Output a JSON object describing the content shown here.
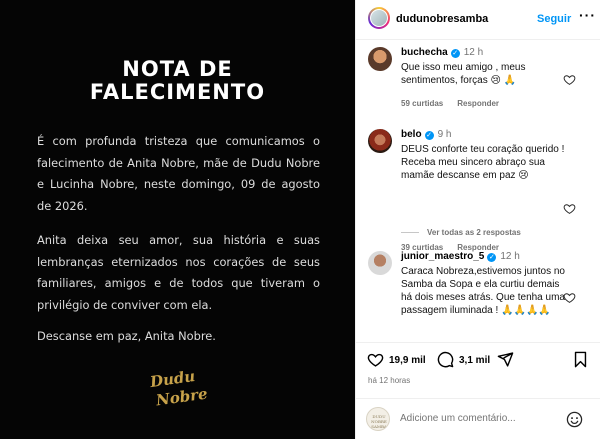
{
  "post": {
    "heading_line1": "NOTA DE",
    "heading_line2": "FALECIMENTO",
    "paragraph1": "É com profunda tristeza que comunicamos o falecimento de Anita Nobre, mãe de Dudu Nobre e Lucinha Nobre, neste domingo, 09 de agosto de 2026.",
    "paragraph2": "Anita deixa seu amor, sua história e suas lembranças eternizados nos corações de seus familiares, amigos e de todos que tiveram o privilégio de conviver com ela.",
    "paragraph3": "Descanse em paz, Anita Nobre.",
    "logo_line1": "Dudu",
    "logo_line2": "Nobre"
  },
  "header": {
    "username": "dudunobresamba",
    "follow_label": "Seguir",
    "more_label": "···"
  },
  "comments": [
    {
      "username": "buchecha",
      "verified": true,
      "time": "12 h",
      "text": "Que isso meu amigo , meus sentimentos, forças 😢 🙏",
      "likes": "59 curtidas",
      "reply_label": "Responder"
    },
    {
      "username": "belo",
      "verified": true,
      "time": "9 h",
      "text": "DEUS conforte teu coração querido ! Receba meu sincero abraço sua mamãe descanse em paz 😢",
      "likes": "39 curtidas",
      "reply_label": "Responder"
    },
    {
      "username": "junior_maestro_5",
      "verified": true,
      "time": "12 h",
      "text": "Caraca Nobreza,estivemos juntos no Samba da Sopa e ela curtiu demais há dois meses atrás. Que tenha uma passagem iluminada ! 🙏🙏🙏🙏",
      "likes": "",
      "reply_label": ""
    }
  ],
  "view_replies": "Ver todas as 2 respostas",
  "actions": {
    "likes_count": "19,9 mil",
    "comments_count": "3,1 mil"
  },
  "posted_time": "há 12 horas",
  "add_comment": {
    "placeholder": "Adicione um comentário...",
    "avatar_text": "DUDU NOBRE SAMBA"
  },
  "colors": {
    "follow": "#0095f6",
    "image_bg": "#050505",
    "logo_gold": "#c7a24a"
  }
}
